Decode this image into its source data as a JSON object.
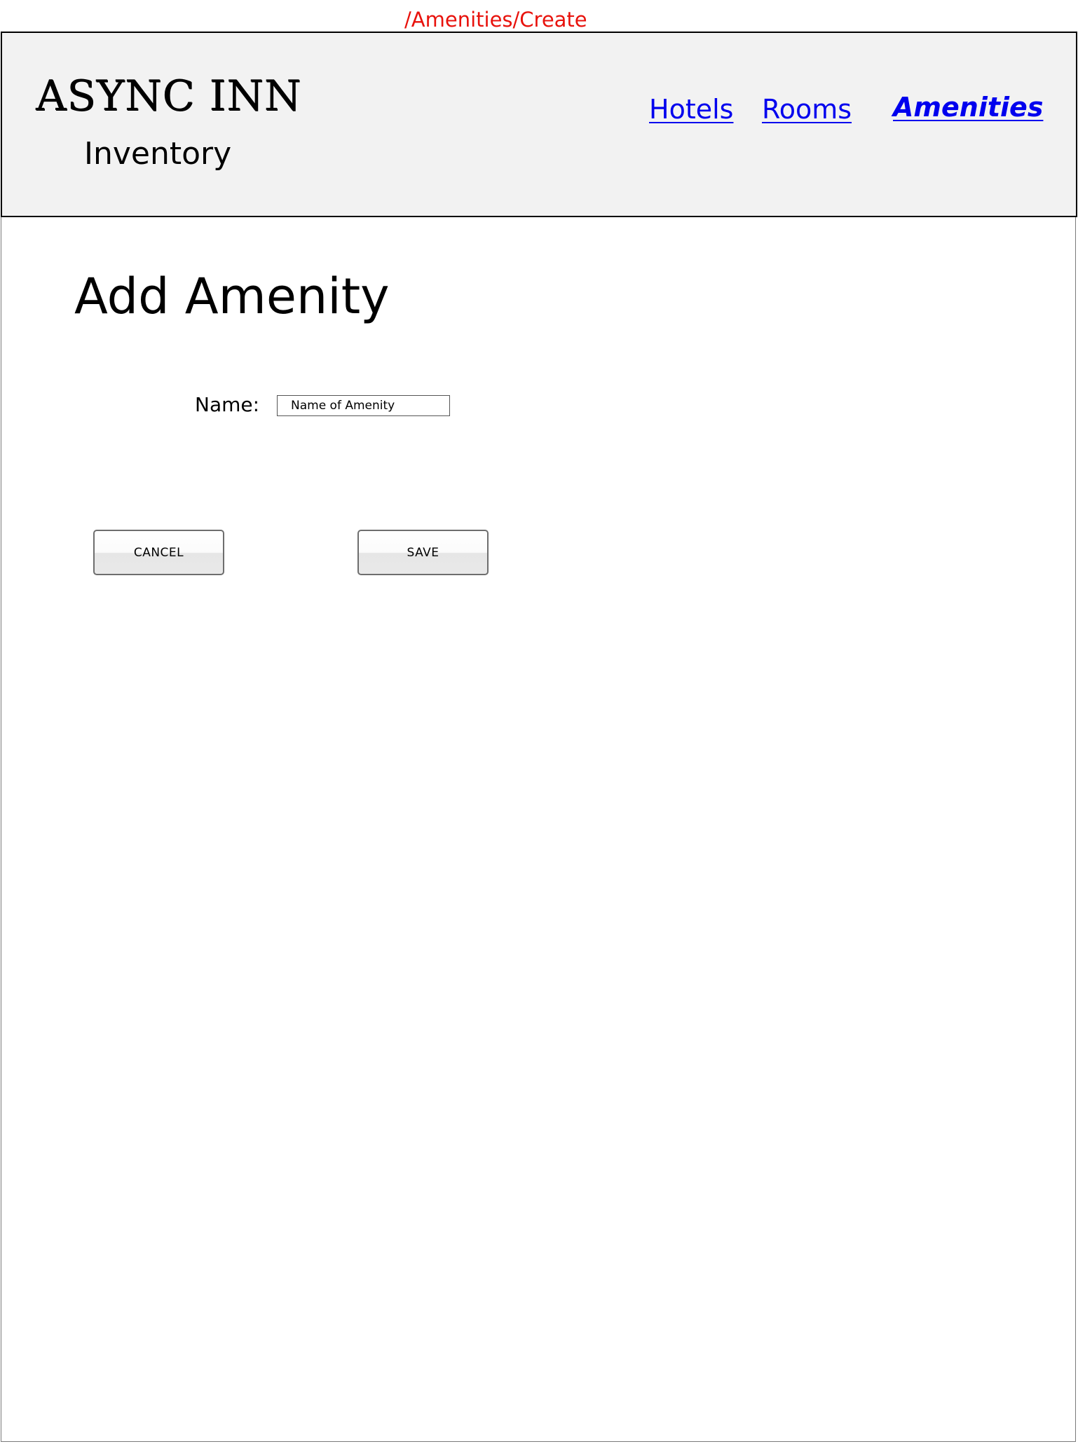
{
  "route": "/Amenities/Create",
  "header": {
    "brand_title": "ASYNC INN",
    "brand_subtitle": "Inventory",
    "nav": {
      "hotels": "Hotels",
      "rooms": "Rooms",
      "amenities": "Amenities",
      "active": "Amenities"
    }
  },
  "main": {
    "title": "Add Amenity",
    "form": {
      "name_label": "Name:",
      "name_placeholder": "Name of Amenity",
      "name_value": ""
    },
    "buttons": {
      "cancel": "CANCEL",
      "save": "SAVE"
    }
  },
  "colors": {
    "route": "#e8120c",
    "link": "#0000ee",
    "header_bg": "#f2f2f2"
  }
}
